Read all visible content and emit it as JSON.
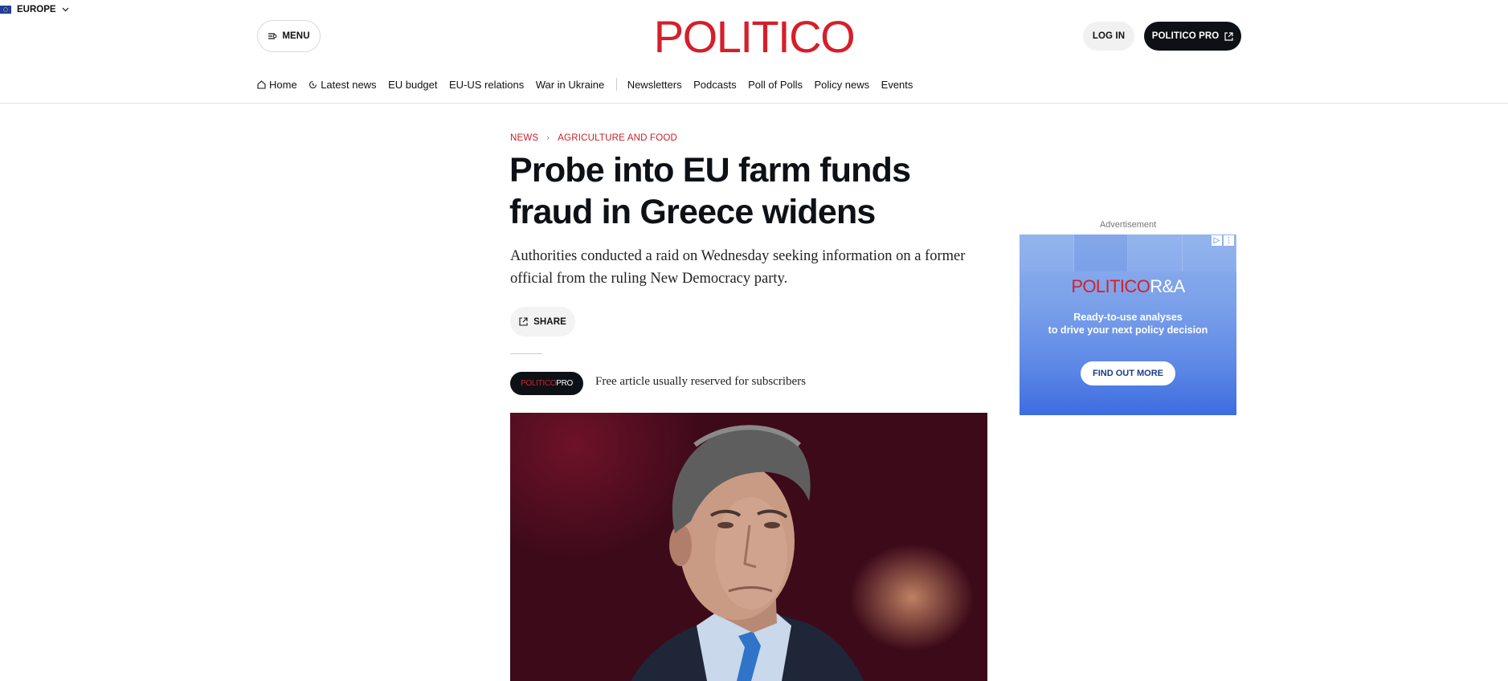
{
  "header": {
    "menu_label": "MENU",
    "region_label": "EUROPE",
    "logo": "POLITICO",
    "login_label": "LOG IN",
    "pro_label": "POLITICO PRO"
  },
  "nav": {
    "items": [
      {
        "label": "Home",
        "icon": "home-icon"
      },
      {
        "label": "Latest news",
        "icon": "clock-icon"
      },
      {
        "label": "EU budget"
      },
      {
        "label": "EU-US relations"
      },
      {
        "label": "War in Ukraine"
      },
      {
        "label": "Newsletters"
      },
      {
        "label": "Podcasts"
      },
      {
        "label": "Poll of Polls"
      },
      {
        "label": "Policy news"
      },
      {
        "label": "Events"
      }
    ]
  },
  "article": {
    "breadcrumb": [
      "NEWS",
      "AGRICULTURE AND FOOD"
    ],
    "headline": "Probe into EU farm funds fraud in Greece widens",
    "dek": "Authorities conducted a raid on Wednesday seeking information on a former official from the ruling New Democracy party.",
    "share_label": "SHARE",
    "pro_badge": {
      "politico": "POLITICO",
      "pro": "PRO"
    },
    "free_note": "Free article usually reserved for subscribers"
  },
  "ad": {
    "label": "Advertisement",
    "logo_red": "POLITICO",
    "logo_white": "R&A",
    "copy_line1": "Ready-to-use analyses",
    "copy_line2": "to drive your next policy decision",
    "cta": "FIND OUT MORE"
  },
  "colors": {
    "brand_red": "#d51f2a",
    "dark": "#0d1116",
    "ad_blue": "#5b86e6"
  }
}
